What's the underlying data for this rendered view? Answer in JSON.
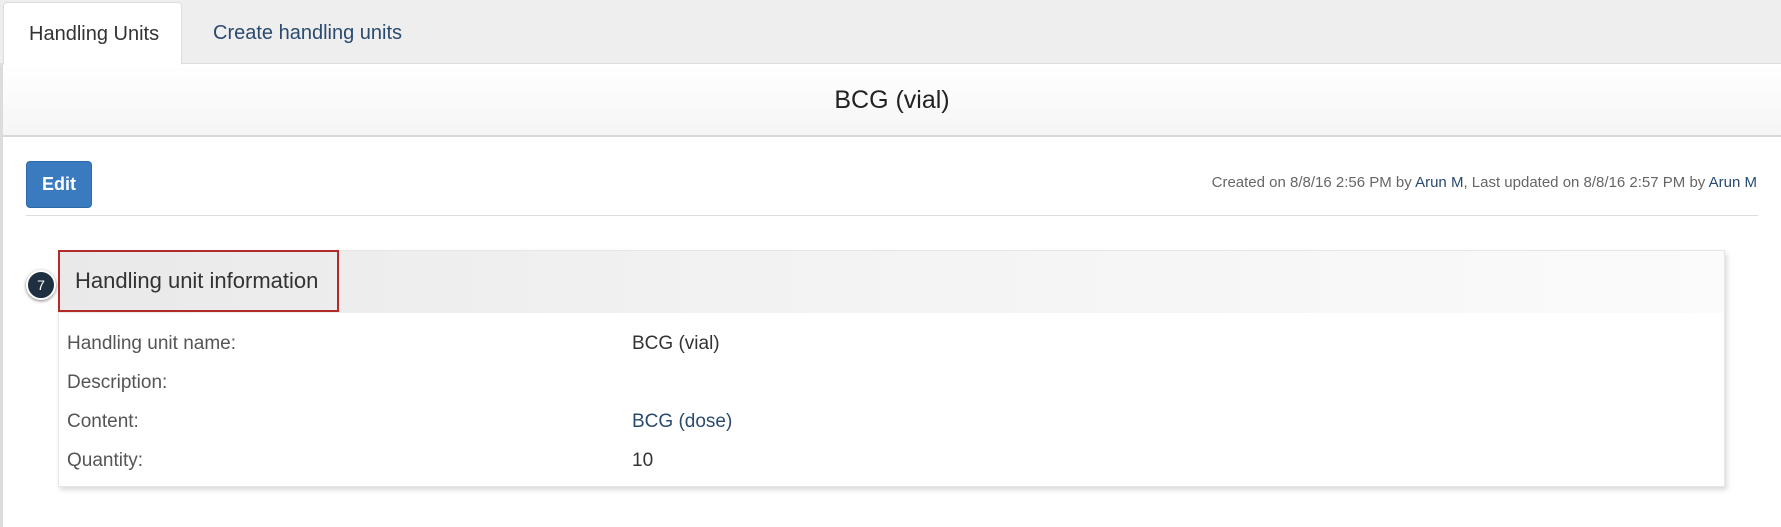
{
  "tabs": [
    {
      "label": "Handling Units",
      "active": true
    },
    {
      "label": "Create handling units",
      "active": false
    }
  ],
  "page": {
    "title": "BCG (vial)"
  },
  "toolbar": {
    "edit_label": "Edit"
  },
  "meta": {
    "created_prefix": "Created on 8/8/16 2:56 PM by ",
    "created_by": "Arun M",
    "updated_prefix": ", Last updated on 8/8/16 2:57 PM by ",
    "updated_by": "Arun M"
  },
  "section": {
    "step_number": "7",
    "title": "Handling unit information",
    "rows": [
      {
        "label": "Handling unit name:",
        "value": "BCG (vial)",
        "link": false
      },
      {
        "label": "Description:",
        "value": "",
        "link": false
      },
      {
        "label": "Content:",
        "value": "BCG (dose)",
        "link": true
      },
      {
        "label": "Quantity:",
        "value": "10",
        "link": false
      }
    ]
  },
  "colors": {
    "accent_button": "#3a7bc0",
    "link": "#2a4a6e",
    "highlight_border": "#b32a2a",
    "badge": "#1e2f42"
  }
}
